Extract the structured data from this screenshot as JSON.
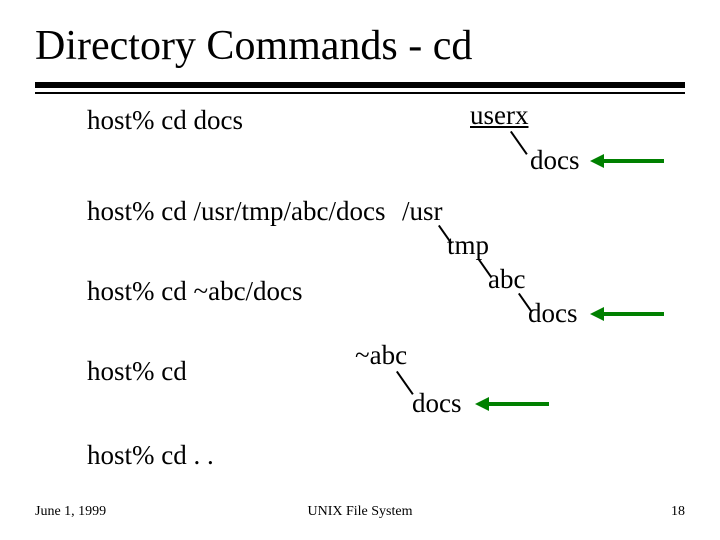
{
  "title": "Directory Commands - cd",
  "commands": {
    "cd_docs": "host% cd docs",
    "cd_abs": "host% cd /usr/tmp/abc/docs",
    "cd_tilde": "host% cd ~abc/docs",
    "cd_home": "host% cd",
    "cd_up": "host% cd . ."
  },
  "tree1": {
    "root": "userx",
    "child": "docs"
  },
  "tree2": {
    "root": "/usr",
    "l1": "tmp",
    "l2": "abc",
    "l3": "docs"
  },
  "tree3": {
    "root": "~abc",
    "child": "docs"
  },
  "footer": {
    "date": "June 1, 1999",
    "center": "UNIX File System",
    "page": "18"
  }
}
